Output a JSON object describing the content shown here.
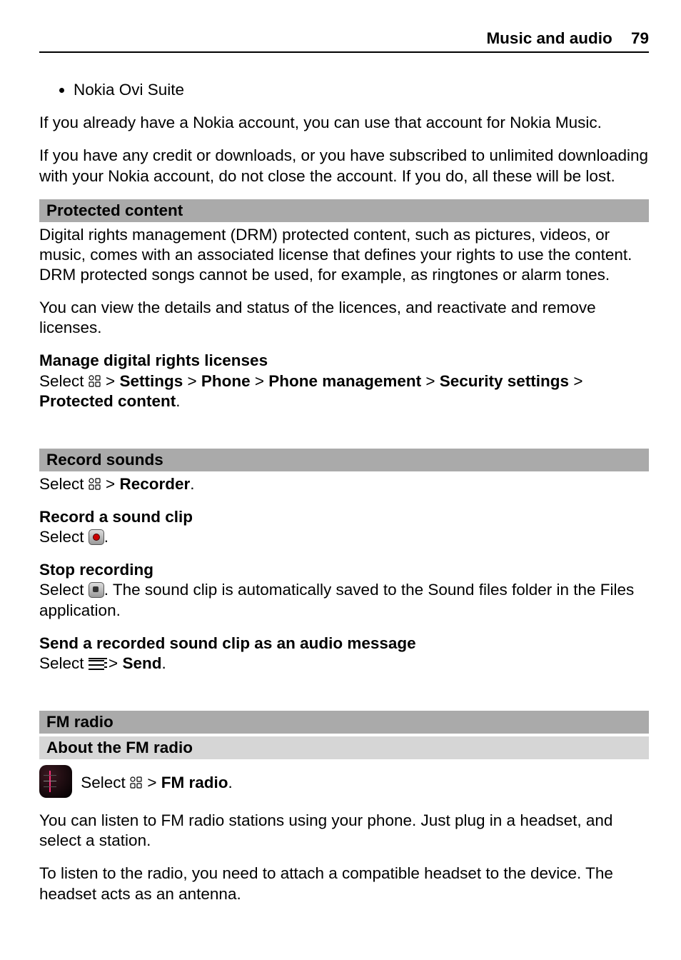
{
  "header": {
    "title": "Music and audio",
    "page": "79"
  },
  "list": {
    "item1": "Nokia Ovi Suite"
  },
  "p_account": "If you already have a Nokia account, you can use that account for Nokia Music.",
  "p_credit": "If you have any credit or downloads, or you have subscribed to unlimited downloading with your Nokia account, do not close the account. If you do, all these will be lost.",
  "protected": {
    "heading": "Protected content",
    "p1": "Digital rights management (DRM) protected content, such as pictures, videos, or music, comes with an associated license that defines your rights to use the content. DRM protected songs cannot be used, for example, as ringtones or alarm tones.",
    "p2": "You can view the details and status of the licences, and reactivate and remove licenses.",
    "manage_heading": "Manage digital rights licenses",
    "nav_select": "Select ",
    "nav_gt1": " > ",
    "nav_settings": "Settings",
    "nav_gt2": " > ",
    "nav_phone": "Phone",
    "nav_gt3": " > ",
    "nav_phonemgmt": "Phone management",
    "nav_gt4": " > ",
    "nav_security": "Security settings",
    "nav_gt5": " > ",
    "nav_protected": "Protected content",
    "period": "."
  },
  "record": {
    "heading": "Record sounds",
    "sel": "Select ",
    "gt": " > ",
    "recorder": "Recorder",
    "period": ".",
    "clip_heading": "Record a sound clip",
    "clip_sel": "Select ",
    "clip_period": ".",
    "stop_heading": "Stop recording",
    "stop_sel": "Select ",
    "stop_rest": ". The sound clip is automatically saved to the Sound files folder in the Files application.",
    "send_heading": "Send a recorded sound clip as an audio message",
    "send_sel": "Select ",
    "send_gt": " > ",
    "send_label": "Send",
    "send_period": "."
  },
  "fm": {
    "heading": "FM radio",
    "about": "About the FM radio",
    "sel": "Select ",
    "gt": " > ",
    "label": "FM radio",
    "period": ".",
    "p1": "You can listen to FM radio stations using your phone. Just plug in a headset, and select a station.",
    "p2": "To listen to the radio, you need to attach a compatible headset to the device. The headset acts as an antenna."
  }
}
